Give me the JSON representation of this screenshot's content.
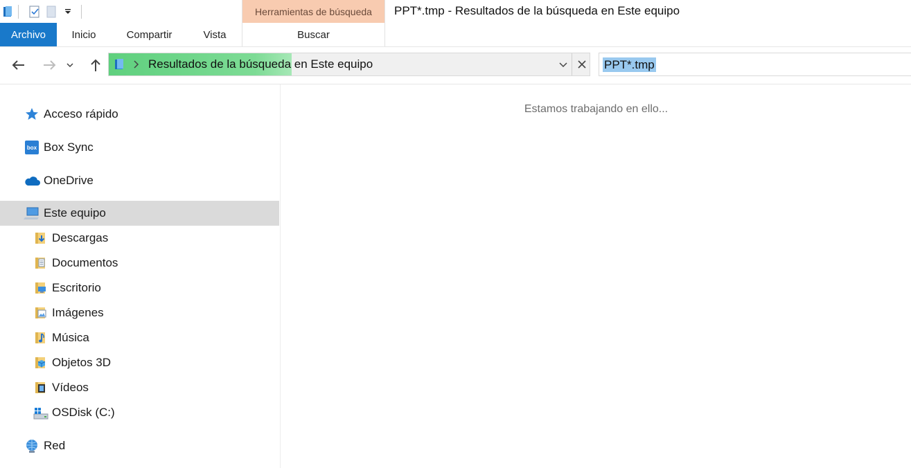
{
  "window": {
    "title": "PPT*.tmp - Resultados de la búsqueda en Este equipo"
  },
  "quick_access_toolbar": {
    "icons": [
      "explorer-icon",
      "properties-icon",
      "new-folder-icon",
      "customize-dropdown-icon"
    ]
  },
  "ribbon": {
    "tabs": [
      {
        "label": "Archivo",
        "active": true
      },
      {
        "label": "Inicio"
      },
      {
        "label": "Compartir"
      },
      {
        "label": "Vista"
      }
    ],
    "contextual_group": {
      "header": "Herramientas de búsqueda",
      "tab": "Buscar",
      "color": "#f8cbb0"
    }
  },
  "navigation": {
    "address": {
      "location": "Resultados de la búsqueda en Este equipo",
      "progress": 0.38
    },
    "search": {
      "value": "PPT*.tmp"
    }
  },
  "nav_pane": {
    "items": [
      {
        "label": "Acceso rápido",
        "icon": "star-icon"
      },
      {
        "label": "Box Sync",
        "icon": "box-icon"
      },
      {
        "label": "OneDrive",
        "icon": "cloud-icon"
      },
      {
        "label": "Este equipo",
        "icon": "computer-icon",
        "selected": true
      },
      {
        "label": "Descargas",
        "icon": "downloads-folder-icon"
      },
      {
        "label": "Documentos",
        "icon": "documents-folder-icon"
      },
      {
        "label": "Escritorio",
        "icon": "desktop-folder-icon"
      },
      {
        "label": "Imágenes",
        "icon": "pictures-folder-icon"
      },
      {
        "label": "Música",
        "icon": "music-folder-icon"
      },
      {
        "label": "Objetos 3D",
        "icon": "3d-objects-folder-icon"
      },
      {
        "label": "Vídeos",
        "icon": "videos-folder-icon"
      },
      {
        "label": "OSDisk (C:)",
        "icon": "drive-icon"
      },
      {
        "label": "Red",
        "icon": "network-icon"
      }
    ]
  },
  "content": {
    "status": "Estamos trabajando en ello..."
  },
  "colors": {
    "accent": "#1979ca",
    "selection": "#dadada",
    "search_highlight": "#99c9ef",
    "progress": "#5fd07e"
  }
}
